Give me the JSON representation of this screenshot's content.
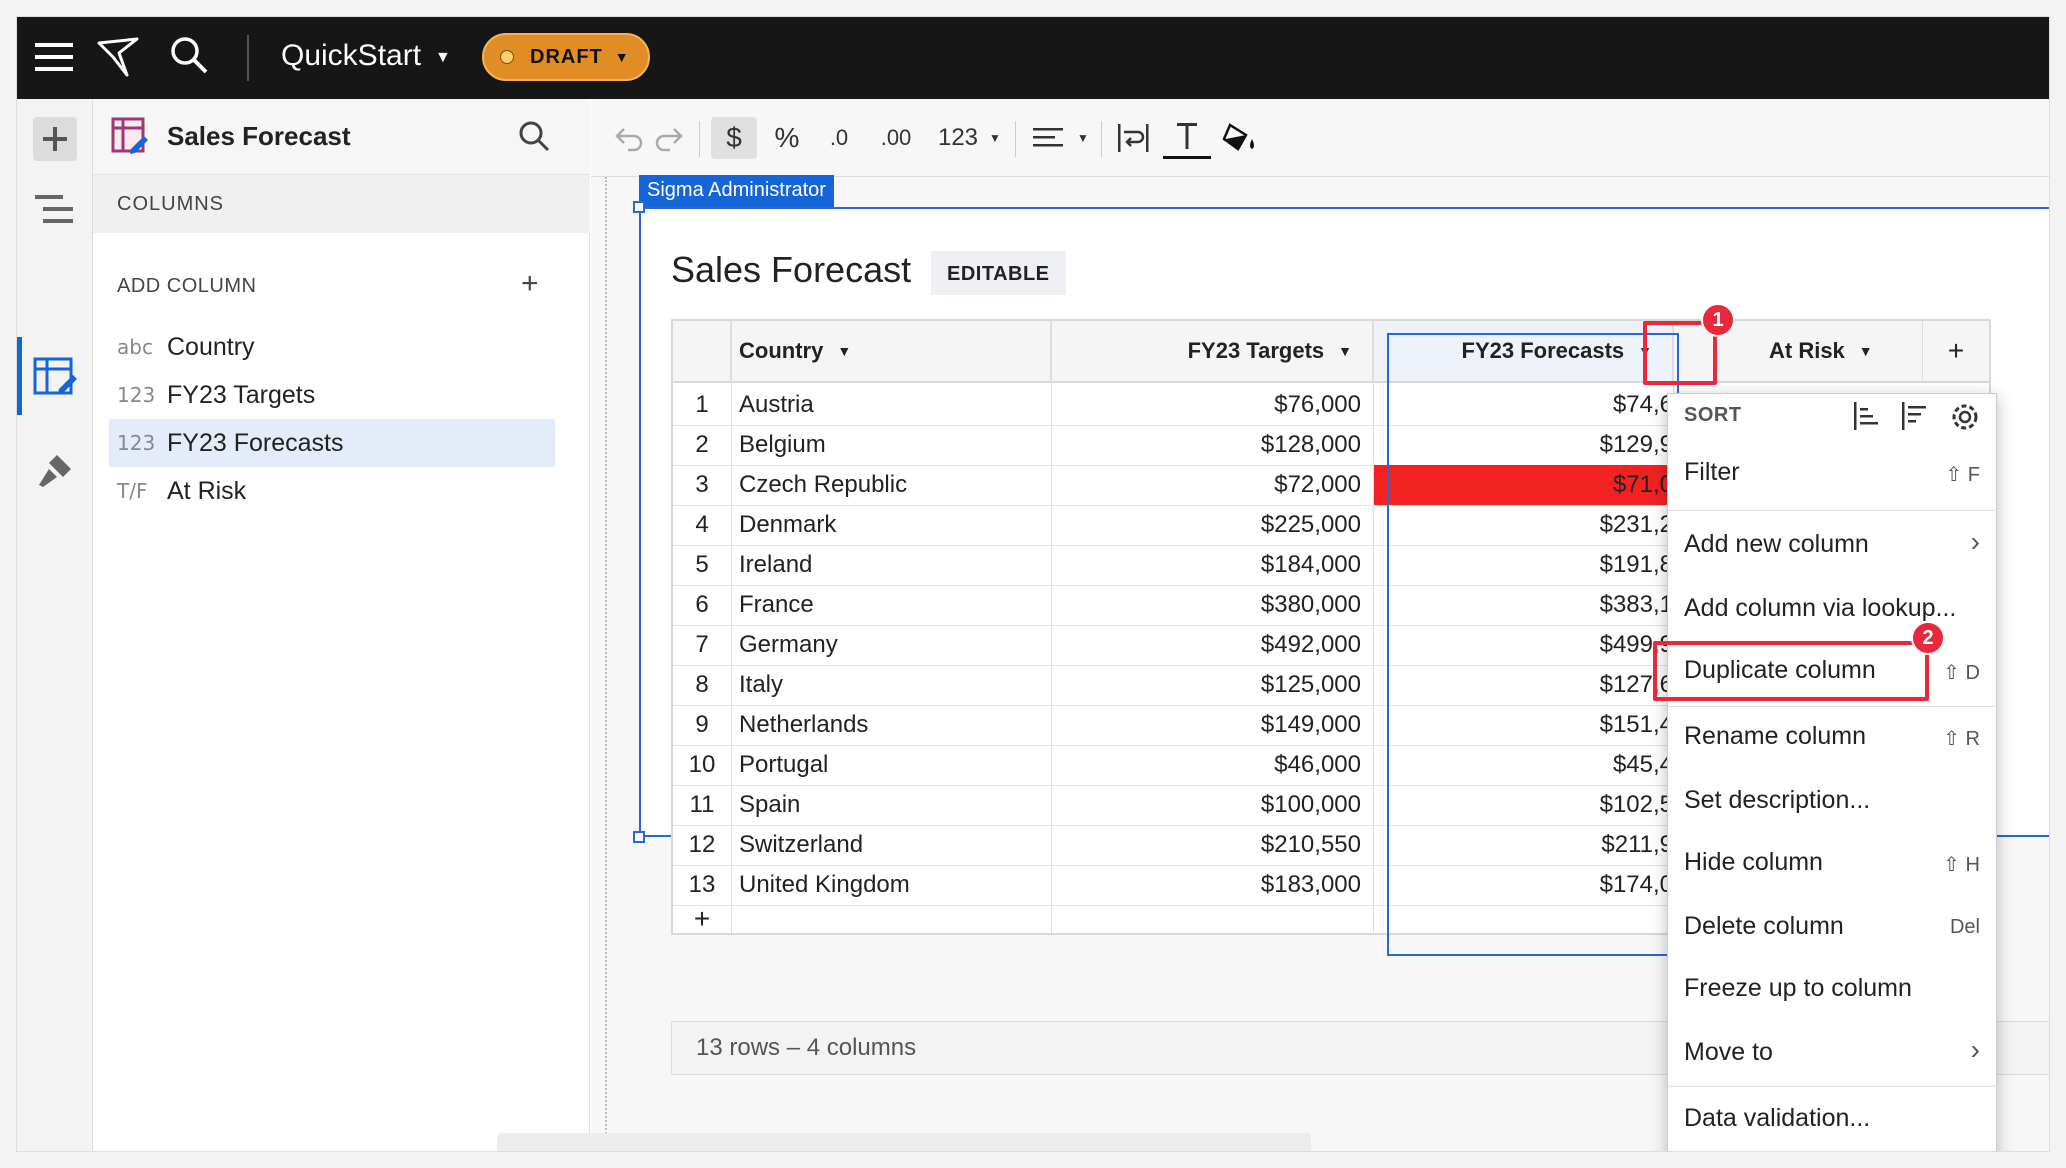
{
  "topbar": {
    "workbook_title": "QuickStart",
    "draft_label": "DRAFT"
  },
  "panel": {
    "title": "Sales Forecast",
    "section_header": "COLUMNS",
    "add_column_label": "ADD COLUMN",
    "add_column_plus": "+",
    "columns": [
      {
        "type": "abc",
        "name": "Country"
      },
      {
        "type": "123",
        "name": "FY23 Targets"
      },
      {
        "type": "123",
        "name": "FY23 Forecasts"
      },
      {
        "type": "T/F",
        "name": "At Risk"
      }
    ]
  },
  "toolbar": {
    "currency": "$",
    "percent": "%",
    "decrease_decimals": ".0",
    "increase_decimals": ".00",
    "number_format": "123"
  },
  "element": {
    "user_tag": "Sigma Administrator",
    "title": "Sales Forecast",
    "badge": "EDITABLE",
    "footer": "13 rows – 4 columns"
  },
  "table": {
    "headers": [
      "Country",
      "FY23 Targets",
      "FY23 Forecasts",
      "At Risk"
    ],
    "add_header": "+",
    "add_row": "+",
    "rows": [
      {
        "n": "1",
        "country": "Austria",
        "target": "$76,000",
        "forecast": "$74,6"
      },
      {
        "n": "2",
        "country": "Belgium",
        "target": "$128,000",
        "forecast": "$129,9"
      },
      {
        "n": "3",
        "country": "Czech Republic",
        "target": "$72,000",
        "forecast": "$71,0"
      },
      {
        "n": "4",
        "country": "Denmark",
        "target": "$225,000",
        "forecast": "$231,2"
      },
      {
        "n": "5",
        "country": "Ireland",
        "target": "$184,000",
        "forecast": "$191,8"
      },
      {
        "n": "6",
        "country": "France",
        "target": "$380,000",
        "forecast": "$383,1"
      },
      {
        "n": "7",
        "country": "Germany",
        "target": "$492,000",
        "forecast": "$499,9"
      },
      {
        "n": "8",
        "country": "Italy",
        "target": "$125,000",
        "forecast": "$127,6"
      },
      {
        "n": "9",
        "country": "Netherlands",
        "target": "$149,000",
        "forecast": "$151,4"
      },
      {
        "n": "10",
        "country": "Portugal",
        "target": "$46,000",
        "forecast": "$45,4"
      },
      {
        "n": "11",
        "country": "Spain",
        "target": "$100,000",
        "forecast": "$102,5"
      },
      {
        "n": "12",
        "country": "Switzerland",
        "target": "$210,550",
        "forecast": "$211,9"
      },
      {
        "n": "13",
        "country": "United Kingdom",
        "target": "$183,000",
        "forecast": "$174,0"
      }
    ],
    "highlight_color": "#f22222"
  },
  "menu": {
    "sort_label": "SORT",
    "items": [
      {
        "label": "Filter",
        "shortcut": "⇧ F"
      },
      {
        "label": "Add new column",
        "shortcut": "›"
      },
      {
        "label": "Add column via lookup...",
        "shortcut": ""
      },
      {
        "label": "Duplicate column",
        "shortcut": "⇧ D"
      },
      {
        "label": "Rename column",
        "shortcut": "⇧ R"
      },
      {
        "label": "Set description...",
        "shortcut": ""
      },
      {
        "label": "Hide column",
        "shortcut": "⇧ H"
      },
      {
        "label": "Delete column",
        "shortcut": "Del"
      },
      {
        "label": "Freeze up to column",
        "shortcut": ""
      },
      {
        "label": "Move to",
        "shortcut": "›"
      },
      {
        "label": "Data validation...",
        "shortcut": ""
      }
    ]
  },
  "callouts": [
    "1",
    "2"
  ],
  "colors": {
    "accent": "#1565d8",
    "draft": "#e08d26",
    "callout": "#e8283c"
  }
}
